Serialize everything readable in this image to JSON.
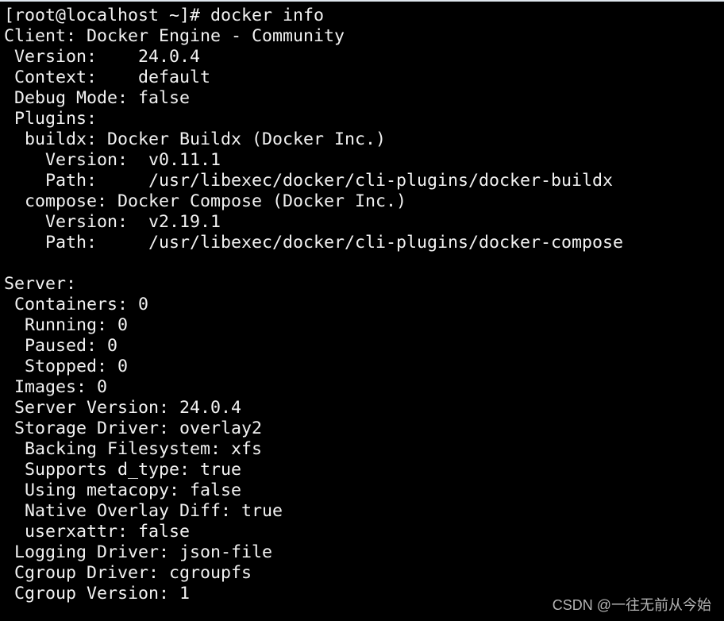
{
  "terminal": {
    "lines": [
      "[root@localhost ~]# docker info",
      "Client: Docker Engine - Community",
      " Version:    24.0.4",
      " Context:    default",
      " Debug Mode: false",
      " Plugins:",
      "  buildx: Docker Buildx (Docker Inc.)",
      "    Version:  v0.11.1",
      "    Path:     /usr/libexec/docker/cli-plugins/docker-buildx",
      "  compose: Docker Compose (Docker Inc.)",
      "    Version:  v2.19.1",
      "    Path:     /usr/libexec/docker/cli-plugins/docker-compose",
      "",
      "Server:",
      " Containers: 0",
      "  Running: 0",
      "  Paused: 0",
      "  Stopped: 0",
      " Images: 0",
      " Server Version: 24.0.4",
      " Storage Driver: overlay2",
      "  Backing Filesystem: xfs",
      "  Supports d_type: true",
      "  Using metacopy: false",
      "  Native Overlay Diff: true",
      "  userxattr: false",
      " Logging Driver: json-file",
      " Cgroup Driver: cgroupfs",
      " Cgroup Version: 1"
    ]
  },
  "watermark": "CSDN @一往无前从今始",
  "colors": {
    "background": "#000000",
    "text": "#f2f2f2",
    "watermark": "#b5b5b5"
  }
}
